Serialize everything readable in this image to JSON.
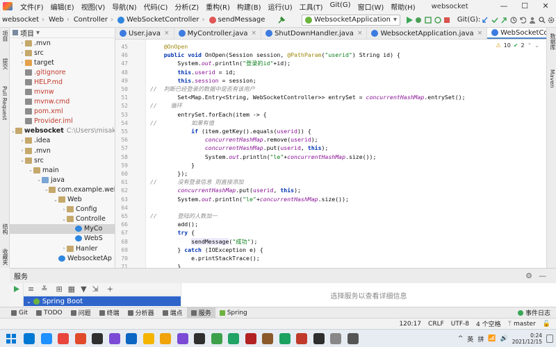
{
  "window": {
    "menus": [
      "文件(F)",
      "编辑(E)",
      "视图(V)",
      "导航(N)",
      "代码(C)",
      "分析(Z)",
      "重构(R)",
      "构建(B)",
      "运行(U)",
      "工具(T)",
      "Git(G)",
      "窗口(W)",
      "帮助(H)"
    ],
    "title": "websocket",
    "controls": [
      "—",
      "☐",
      "✕"
    ]
  },
  "breadcrumb": [
    "websocket",
    "Web",
    "Controller",
    "WebSocketController",
    "sendMessage"
  ],
  "run_config": "WebsocketApplication",
  "git_label": "Git(G):",
  "project_panel": {
    "title": "项目",
    "tree": [
      {
        "indent": 1,
        "arrow": "›",
        "icon": "folder",
        "label": ".mvn"
      },
      {
        "indent": 1,
        "arrow": "›",
        "icon": "folder",
        "label": "src"
      },
      {
        "indent": 1,
        "arrow": "›",
        "icon": "folder-orange",
        "label": "target"
      },
      {
        "indent": 1,
        "arrow": "",
        "icon": "file",
        "label": ".gitignore",
        "color": "#c0392b"
      },
      {
        "indent": 1,
        "arrow": "",
        "icon": "file",
        "label": "HELP.md",
        "color": "#c0392b"
      },
      {
        "indent": 1,
        "arrow": "",
        "icon": "file",
        "label": "mvnw",
        "color": "#c0392b"
      },
      {
        "indent": 1,
        "arrow": "",
        "icon": "file",
        "label": "mvnw.cmd",
        "color": "#c0392b"
      },
      {
        "indent": 1,
        "arrow": "",
        "icon": "file",
        "label": "pom.xml",
        "color": "#c0392b"
      },
      {
        "indent": 1,
        "arrow": "",
        "icon": "file",
        "label": "Provider.iml",
        "color": "#c0392b"
      },
      {
        "indent": 0,
        "arrow": "⌄",
        "icon": "folder",
        "label": "websocket",
        "bold": true,
        "muted": "C:\\Users\\misak\\Ide"
      },
      {
        "indent": 1,
        "arrow": "›",
        "icon": "folder",
        "label": ".idea"
      },
      {
        "indent": 1,
        "arrow": "›",
        "icon": "folder",
        "label": ".mvn"
      },
      {
        "indent": 1,
        "arrow": "⌄",
        "icon": "folder",
        "label": "src"
      },
      {
        "indent": 2,
        "arrow": "⌄",
        "icon": "folder",
        "label": "main"
      },
      {
        "indent": 3,
        "arrow": "⌄",
        "icon": "folder-blue",
        "label": "java"
      },
      {
        "indent": 4,
        "arrow": "⌄",
        "icon": "folder",
        "label": "com.example.wel"
      },
      {
        "indent": 5,
        "arrow": "⌄",
        "icon": "folder",
        "label": "Web"
      },
      {
        "indent": 6,
        "arrow": "›",
        "icon": "folder",
        "label": "Config"
      },
      {
        "indent": 6,
        "arrow": "⌄",
        "icon": "folder",
        "label": "Controlle"
      },
      {
        "indent": 7,
        "arrow": "",
        "icon": "class",
        "label": "MyCo",
        "selected": true
      },
      {
        "indent": 7,
        "arrow": "",
        "icon": "class",
        "label": "WebS"
      },
      {
        "indent": 6,
        "arrow": "›",
        "icon": "folder",
        "label": "Hanler"
      },
      {
        "indent": 5,
        "arrow": "",
        "icon": "class",
        "label": "WebsocketAp"
      }
    ]
  },
  "tabs": [
    {
      "label": "User.java",
      "color": "#3c7be0"
    },
    {
      "label": "MyController.java",
      "color": "#3c7be0"
    },
    {
      "label": "ShutDownHandler.java",
      "color": "#3c7be0"
    },
    {
      "label": "WebsocketApplication.java",
      "color": "#3c7be0"
    },
    {
      "label": "WebSocketController.java",
      "color": "#3c7be0",
      "active": true
    },
    {
      "label": "WebSo",
      "color": "#3c7be0"
    }
  ],
  "inspections": {
    "warnings": "10",
    "weak": "2"
  },
  "code_lines": [
    {
      "n": "45",
      "html": "    <span class=\"an\">@OnOpen</span>"
    },
    {
      "n": "46",
      "html": "    <span class=\"kw\">public void</span> OnOpen(Session session, <span class=\"an\">@PathParam</span>(<span class=\"st\">\"userid\"</span>) String id) {"
    },
    {
      "n": "47",
      "html": "        System.<span class=\"fd\">out</span>.println(<span class=\"st\">\"登录的id\"</span>+id);"
    },
    {
      "n": "48",
      "html": "        <span class=\"kw\">this</span>.<span class=\"fd\" style=\"font-style:normal\">userid</span> = id;"
    },
    {
      "n": "49",
      "html": "        <span class=\"kw\">this</span>.<span class=\"fd\" style=\"font-style:normal\">session</span> = session;"
    },
    {
      "n": "50",
      "html": "<span class=\"cm\">//  判断已经登录的数据中是否有该用户</span>"
    },
    {
      "n": "51",
      "html": "        Set&lt;Map.Entry&lt;String, WebSocketController&gt;&gt; entrySet = <span class=\"fd\">concurrentHashMap</span>.entrySet();"
    },
    {
      "n": "52",
      "html": "<span class=\"cm\">//    循环</span>"
    },
    {
      "n": "53",
      "html": "        entrySet.forEach(item -&gt; {"
    },
    {
      "n": "54",
      "html": "<span class=\"cm\">//          如果有值</span>"
    },
    {
      "n": "55",
      "html": "            <span class=\"kw\">if</span> (item.getKey().equals(<span class=\"fd\" style=\"font-style:normal\">userid</span>)) {"
    },
    {
      "n": "56",
      "html": "                <span class=\"fd\">concurrentHashMap</span>.remove(<span class=\"fd\" style=\"font-style:normal\">userid</span>);"
    },
    {
      "n": "57",
      "html": "                <span class=\"fd\">concurrentHashMap</span>.put(<span class=\"fd\" style=\"font-style:normal\">userid</span>, <span class=\"kw\">this</span>);"
    },
    {
      "n": "58",
      "html": "                System.<span class=\"fd\">out</span>.println(<span class=\"st\">\"le\"</span>+<span class=\"fd\">concurrentHashMap</span>.size());"
    },
    {
      "n": "59",
      "html": "            }"
    },
    {
      "n": "60",
      "html": "        });"
    },
    {
      "n": "61",
      "html": "<span class=\"cm\">//      没有登录信息 则直接添加</span>"
    },
    {
      "n": "62",
      "html": "        <span class=\"fd\">concurrentHashMap</span>.put(<span class=\"fd\" style=\"font-style:normal\">userid</span>, <span class=\"kw\">this</span>);"
    },
    {
      "n": "63",
      "html": "        System.<span class=\"fd\">out</span>.println(<span class=\"st\">\"le\"</span>+<span class=\"fd\">concurrentHashMap</span>.size());"
    },
    {
      "n": "64",
      "html": ""
    },
    {
      "n": "65",
      "html": "<span class=\"cm\">//      登陆的人数加一</span>"
    },
    {
      "n": "66",
      "html": "        add();"
    },
    {
      "n": "67",
      "html": "        <span class=\"kw\">try</span> {"
    },
    {
      "n": "68",
      "html": "            <span class=\"hl\">sendMessage</span>(<span class=\"st\">\"成功\"</span>);"
    },
    {
      "n": "69",
      "html": "        } <span class=\"kw\">catch</span> (IOException e) {"
    },
    {
      "n": "70",
      "html": "            e.printStackTrace();"
    },
    {
      "n": "71",
      "html": "        }"
    }
  ],
  "left_strip": [
    "项目",
    "提交",
    "Pull Request",
    "结构",
    "收藏夹"
  ],
  "right_strip": [
    "数据库",
    "Maven"
  ],
  "services": {
    "title": "服务",
    "tree_item": "Spring Boot",
    "placeholder": "选择服务以查看详细信息"
  },
  "bottom_tools": [
    {
      "label": "Git",
      "color": "#6a6a6a"
    },
    {
      "label": "TODO",
      "color": "#6a6a6a"
    },
    {
      "label": "问题",
      "color": "#6a6a6a"
    },
    {
      "label": "终端",
      "color": "#6a6a6a"
    },
    {
      "label": "分析器",
      "color": "#6a6a6a"
    },
    {
      "label": "端点",
      "color": "#6a6a6a"
    },
    {
      "label": "服务",
      "color": "#6a6a6a",
      "active": true
    },
    {
      "label": "Spring",
      "color": "#6db33f"
    }
  ],
  "event_log": "事件日志",
  "status": {
    "position": "120:17",
    "line_sep": "CRLF",
    "encoding": "UTF-8",
    "indent": "4 个空格",
    "branch": "master"
  },
  "taskbar": {
    "apps": [
      "#0078d4",
      "#1e90ff",
      "#e8453c",
      "#e04a2a",
      "#2f2f2f",
      "#7b4bd6",
      "#0a66c2",
      "#f4b400",
      "#f0a30a",
      "#7b4bd6",
      "#2f2f2f",
      "#3ca14a",
      "#21a366",
      "#b22222",
      "#8b5a2b",
      "#1aa260",
      "#c0392b",
      "#2f2f2f",
      "#888888",
      "#555555"
    ],
    "tray": [
      "^",
      "英",
      "拼"
    ],
    "time": "0:24",
    "date": "2021/12/15"
  }
}
